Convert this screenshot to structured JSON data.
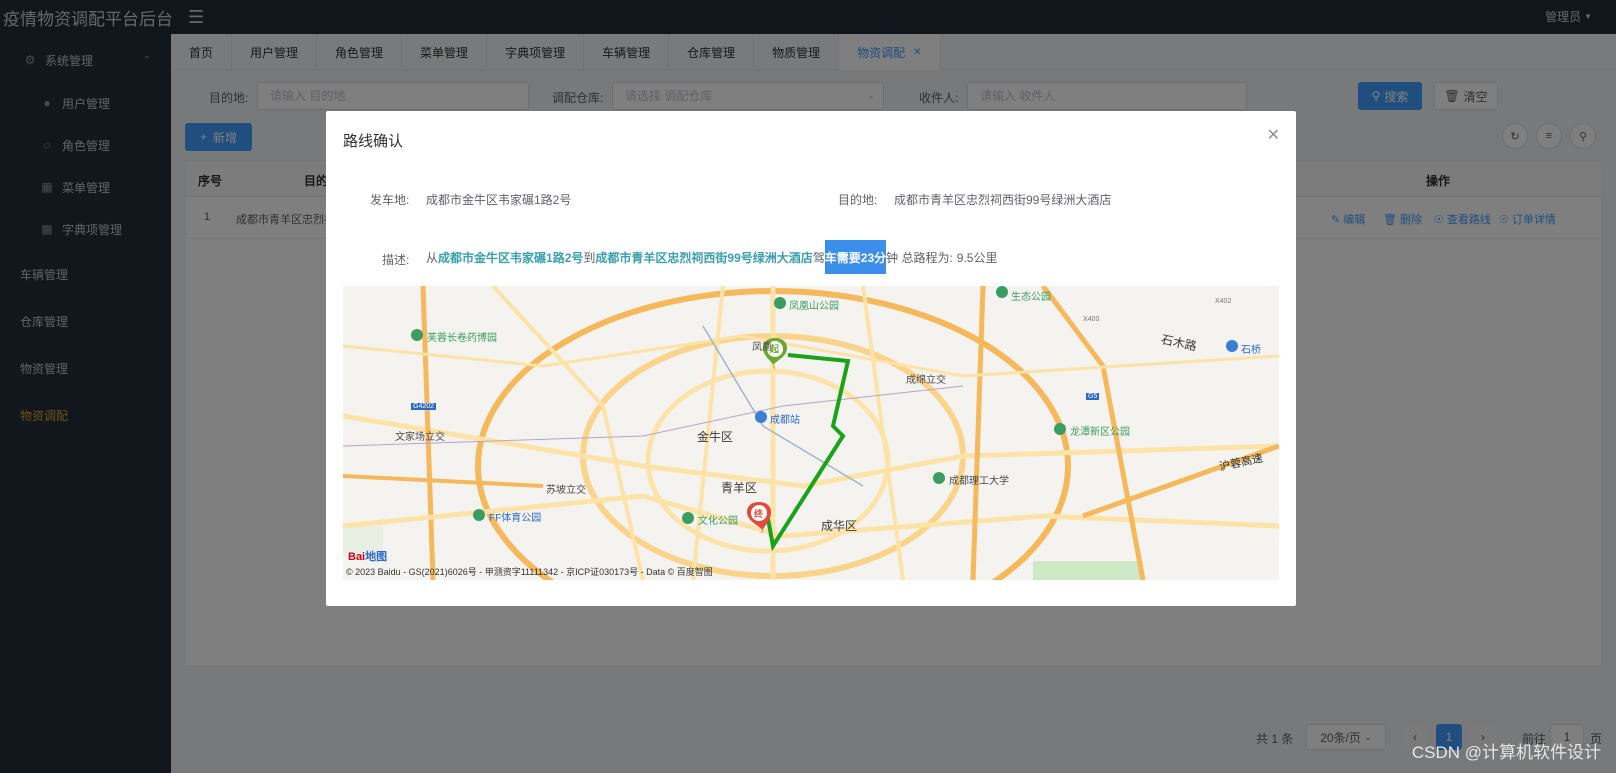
{
  "app": {
    "title": "疫情物资调配平台后台",
    "user": "管理员"
  },
  "sidebar": {
    "items": [
      {
        "label": "系统管理",
        "icon": "gear-icon"
      },
      {
        "label": "用户管理",
        "icon": "user-icon"
      },
      {
        "label": "角色管理",
        "icon": "person-outline-icon"
      },
      {
        "label": "菜单管理",
        "icon": "grid-icon"
      },
      {
        "label": "字典项管理",
        "icon": "apps-icon"
      },
      {
        "label": "车辆管理"
      },
      {
        "label": "仓库管理"
      },
      {
        "label": "物资管理"
      },
      {
        "label": "物资调配"
      }
    ]
  },
  "tabs": [
    "首页",
    "用户管理",
    "角色管理",
    "菜单管理",
    "字典项管理",
    "车辆管理",
    "仓库管理",
    "物质管理",
    "物资调配"
  ],
  "search": {
    "dest_label": "目的地:",
    "dest_placeholder": "请输入 目的地",
    "warehouse_label": "调配仓库:",
    "warehouse_placeholder": "请选择 调配仓库",
    "receiver_label": "收件人:",
    "receiver_placeholder": "请输入 收件人",
    "search_btn": "搜索",
    "clear_btn": "清空",
    "add_btn": "新增"
  },
  "table": {
    "headers": {
      "index": "序号",
      "dest": "目的",
      "ops": "操作"
    },
    "row": {
      "index": "1",
      "dest": "成都市青羊区忠烈祠"
    },
    "ops": [
      "编辑",
      "删除",
      "查看路线",
      "订单详情"
    ]
  },
  "pager": {
    "total": "共 1 条",
    "page_size": "20条/页",
    "current": "1",
    "goto": "前往",
    "goto_value": "1",
    "page_unit": "页"
  },
  "dialog": {
    "title": "路线确认",
    "from_label": "发车地:",
    "from_value": "成都市金牛区韦家碾1路2号",
    "to_label": "目的地:",
    "to_value": "成都市青羊区忠烈祠西街99号绿洲大酒店",
    "desc_label": "描述:",
    "desc_p1": "从",
    "desc_from": "成都市金牛区韦家碾1路2号",
    "desc_p2": "到",
    "desc_to": "成都市青羊区忠烈祠西街99号绿洲大酒店",
    "desc_p3": "驾",
    "desc_sel": "车需要23分",
    "desc_p4": "钟 总路程为:",
    "desc_dist": "9.5公里"
  },
  "map": {
    "labels": {
      "fenghuangshan": "凤凰山公园",
      "furong": "芙蓉长卷药博园",
      "shimulu": "石木路",
      "chengluo": "成绵立交",
      "chengdu_station": "成都站",
      "jinniu": "金牛区",
      "wenjia": "文家场立交",
      "longtan": "龙潭新区公园",
      "suba": "苏坡立交",
      "qingyang": "青羊区",
      "hurong": "沪蓉高速",
      "ligong": "成都理工大学",
      "ff_park": "FF体育公园",
      "wenhua": "文化公园",
      "chenghua": "成华区",
      "fenghuang_short": "凤凰",
      "start_marker": "起",
      "end_marker": "终",
      "g4202": "G4202",
      "g5": "G5",
      "x402": "X402",
      "x400": "X400",
      "shengtai": "生态公园",
      "shi": "石桥"
    },
    "copyright": "© 2023 Baidu - GS(2021)6026号 - 甲测资字11111342 - 京ICP证030173号 - Data © 百度智图",
    "logo_bai": "Bai",
    "logo_du": "地图"
  },
  "watermark": "CSDN @计算机软件设计"
}
